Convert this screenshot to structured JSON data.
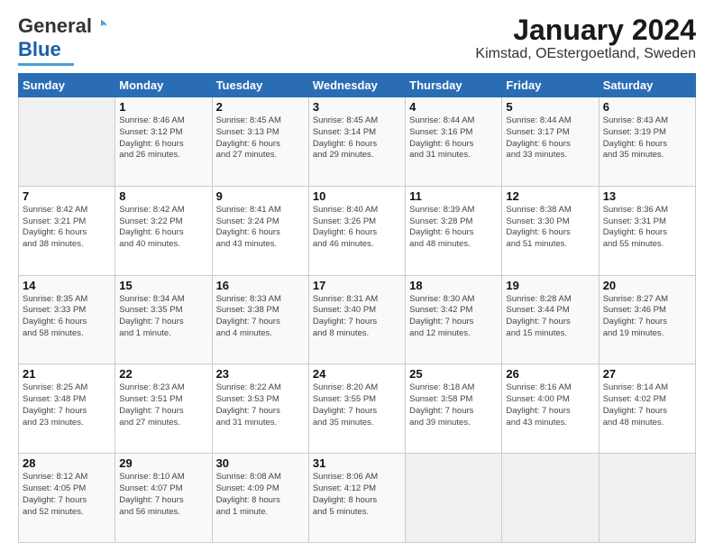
{
  "header": {
    "logo_general": "General",
    "logo_blue": "Blue",
    "title": "January 2024",
    "subtitle": "Kimstad, OEstergoetland, Sweden"
  },
  "calendar": {
    "days_of_week": [
      "Sunday",
      "Monday",
      "Tuesday",
      "Wednesday",
      "Thursday",
      "Friday",
      "Saturday"
    ],
    "weeks": [
      [
        {
          "day": "",
          "info": ""
        },
        {
          "day": "1",
          "info": "Sunrise: 8:46 AM\nSunset: 3:12 PM\nDaylight: 6 hours\nand 26 minutes."
        },
        {
          "day": "2",
          "info": "Sunrise: 8:45 AM\nSunset: 3:13 PM\nDaylight: 6 hours\nand 27 minutes."
        },
        {
          "day": "3",
          "info": "Sunrise: 8:45 AM\nSunset: 3:14 PM\nDaylight: 6 hours\nand 29 minutes."
        },
        {
          "day": "4",
          "info": "Sunrise: 8:44 AM\nSunset: 3:16 PM\nDaylight: 6 hours\nand 31 minutes."
        },
        {
          "day": "5",
          "info": "Sunrise: 8:44 AM\nSunset: 3:17 PM\nDaylight: 6 hours\nand 33 minutes."
        },
        {
          "day": "6",
          "info": "Sunrise: 8:43 AM\nSunset: 3:19 PM\nDaylight: 6 hours\nand 35 minutes."
        }
      ],
      [
        {
          "day": "7",
          "info": "Sunrise: 8:42 AM\nSunset: 3:21 PM\nDaylight: 6 hours\nand 38 minutes."
        },
        {
          "day": "8",
          "info": "Sunrise: 8:42 AM\nSunset: 3:22 PM\nDaylight: 6 hours\nand 40 minutes."
        },
        {
          "day": "9",
          "info": "Sunrise: 8:41 AM\nSunset: 3:24 PM\nDaylight: 6 hours\nand 43 minutes."
        },
        {
          "day": "10",
          "info": "Sunrise: 8:40 AM\nSunset: 3:26 PM\nDaylight: 6 hours\nand 46 minutes."
        },
        {
          "day": "11",
          "info": "Sunrise: 8:39 AM\nSunset: 3:28 PM\nDaylight: 6 hours\nand 48 minutes."
        },
        {
          "day": "12",
          "info": "Sunrise: 8:38 AM\nSunset: 3:30 PM\nDaylight: 6 hours\nand 51 minutes."
        },
        {
          "day": "13",
          "info": "Sunrise: 8:36 AM\nSunset: 3:31 PM\nDaylight: 6 hours\nand 55 minutes."
        }
      ],
      [
        {
          "day": "14",
          "info": "Sunrise: 8:35 AM\nSunset: 3:33 PM\nDaylight: 6 hours\nand 58 minutes."
        },
        {
          "day": "15",
          "info": "Sunrise: 8:34 AM\nSunset: 3:35 PM\nDaylight: 7 hours\nand 1 minute."
        },
        {
          "day": "16",
          "info": "Sunrise: 8:33 AM\nSunset: 3:38 PM\nDaylight: 7 hours\nand 4 minutes."
        },
        {
          "day": "17",
          "info": "Sunrise: 8:31 AM\nSunset: 3:40 PM\nDaylight: 7 hours\nand 8 minutes."
        },
        {
          "day": "18",
          "info": "Sunrise: 8:30 AM\nSunset: 3:42 PM\nDaylight: 7 hours\nand 12 minutes."
        },
        {
          "day": "19",
          "info": "Sunrise: 8:28 AM\nSunset: 3:44 PM\nDaylight: 7 hours\nand 15 minutes."
        },
        {
          "day": "20",
          "info": "Sunrise: 8:27 AM\nSunset: 3:46 PM\nDaylight: 7 hours\nand 19 minutes."
        }
      ],
      [
        {
          "day": "21",
          "info": "Sunrise: 8:25 AM\nSunset: 3:48 PM\nDaylight: 7 hours\nand 23 minutes."
        },
        {
          "day": "22",
          "info": "Sunrise: 8:23 AM\nSunset: 3:51 PM\nDaylight: 7 hours\nand 27 minutes."
        },
        {
          "day": "23",
          "info": "Sunrise: 8:22 AM\nSunset: 3:53 PM\nDaylight: 7 hours\nand 31 minutes."
        },
        {
          "day": "24",
          "info": "Sunrise: 8:20 AM\nSunset: 3:55 PM\nDaylight: 7 hours\nand 35 minutes."
        },
        {
          "day": "25",
          "info": "Sunrise: 8:18 AM\nSunset: 3:58 PM\nDaylight: 7 hours\nand 39 minutes."
        },
        {
          "day": "26",
          "info": "Sunrise: 8:16 AM\nSunset: 4:00 PM\nDaylight: 7 hours\nand 43 minutes."
        },
        {
          "day": "27",
          "info": "Sunrise: 8:14 AM\nSunset: 4:02 PM\nDaylight: 7 hours\nand 48 minutes."
        }
      ],
      [
        {
          "day": "28",
          "info": "Sunrise: 8:12 AM\nSunset: 4:05 PM\nDaylight: 7 hours\nand 52 minutes."
        },
        {
          "day": "29",
          "info": "Sunrise: 8:10 AM\nSunset: 4:07 PM\nDaylight: 7 hours\nand 56 minutes."
        },
        {
          "day": "30",
          "info": "Sunrise: 8:08 AM\nSunset: 4:09 PM\nDaylight: 8 hours\nand 1 minute."
        },
        {
          "day": "31",
          "info": "Sunrise: 8:06 AM\nSunset: 4:12 PM\nDaylight: 8 hours\nand 5 minutes."
        },
        {
          "day": "",
          "info": ""
        },
        {
          "day": "",
          "info": ""
        },
        {
          "day": "",
          "info": ""
        }
      ]
    ]
  }
}
